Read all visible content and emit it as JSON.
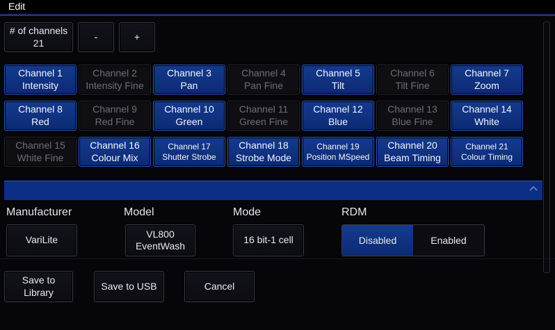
{
  "window": {
    "title": "Edit"
  },
  "channel_count": {
    "label": "# of channels",
    "value": "21",
    "minus": "-",
    "plus": "+"
  },
  "channels": [
    {
      "name": "Channel 1",
      "desc": "Intensity",
      "state": "selected"
    },
    {
      "name": "Channel 2",
      "desc": "Intensity Fine",
      "state": "disabled"
    },
    {
      "name": "Channel 3",
      "desc": "Pan",
      "state": "selected"
    },
    {
      "name": "Channel 4",
      "desc": "Pan Fine",
      "state": "disabled"
    },
    {
      "name": "Channel 5",
      "desc": "Tilt",
      "state": "selected"
    },
    {
      "name": "Channel 6",
      "desc": "Tilt Fine",
      "state": "disabled"
    },
    {
      "name": "Channel 7",
      "desc": "Zoom",
      "state": "selected"
    },
    {
      "name": "Channel 8",
      "desc": "Red",
      "state": "selected"
    },
    {
      "name": "Channel 9",
      "desc": "Red Fine",
      "state": "disabled"
    },
    {
      "name": "Channel 10",
      "desc": "Green",
      "state": "selected"
    },
    {
      "name": "Channel 11",
      "desc": "Green Fine",
      "state": "disabled"
    },
    {
      "name": "Channel 12",
      "desc": "Blue",
      "state": "selected"
    },
    {
      "name": "Channel 13",
      "desc": "Blue Fine",
      "state": "disabled"
    },
    {
      "name": "Channel 14",
      "desc": "White",
      "state": "selected"
    },
    {
      "name": "Channel 15",
      "desc": "White Fine",
      "state": "disabled"
    },
    {
      "name": "Channel 16",
      "desc": "Colour Mix",
      "state": "selected"
    },
    {
      "name": "Channel 17",
      "desc": "Shutter Strobe",
      "state": "selected"
    },
    {
      "name": "Channel 18",
      "desc": "Strobe Mode",
      "state": "selected"
    },
    {
      "name": "Channel 19",
      "desc": "Position MSpeed",
      "state": "selected"
    },
    {
      "name": "Channel 20",
      "desc": "Beam Timing",
      "state": "selected"
    },
    {
      "name": "Channel 21",
      "desc": "Colour Timing",
      "state": "selected"
    }
  ],
  "details": {
    "manufacturer": {
      "label": "Manufacturer",
      "value": "VariLite"
    },
    "model": {
      "label": "Model",
      "line1": "VL800",
      "line2": "EventWash"
    },
    "mode": {
      "label": "Mode",
      "value": "16 bit-1 cell"
    },
    "rdm": {
      "label": "RDM",
      "options": [
        "Disabled",
        "Enabled"
      ],
      "selected": "Disabled"
    }
  },
  "actions": {
    "save_library_line1": "Save to",
    "save_library_line2": "Library",
    "save_usb": "Save to USB",
    "cancel": "Cancel"
  },
  "colors": {
    "accent": "#0d2e85",
    "selected_button": "#143a8e",
    "background": "#05050a"
  },
  "icons": {
    "collapse": "chevron-up-icon"
  }
}
